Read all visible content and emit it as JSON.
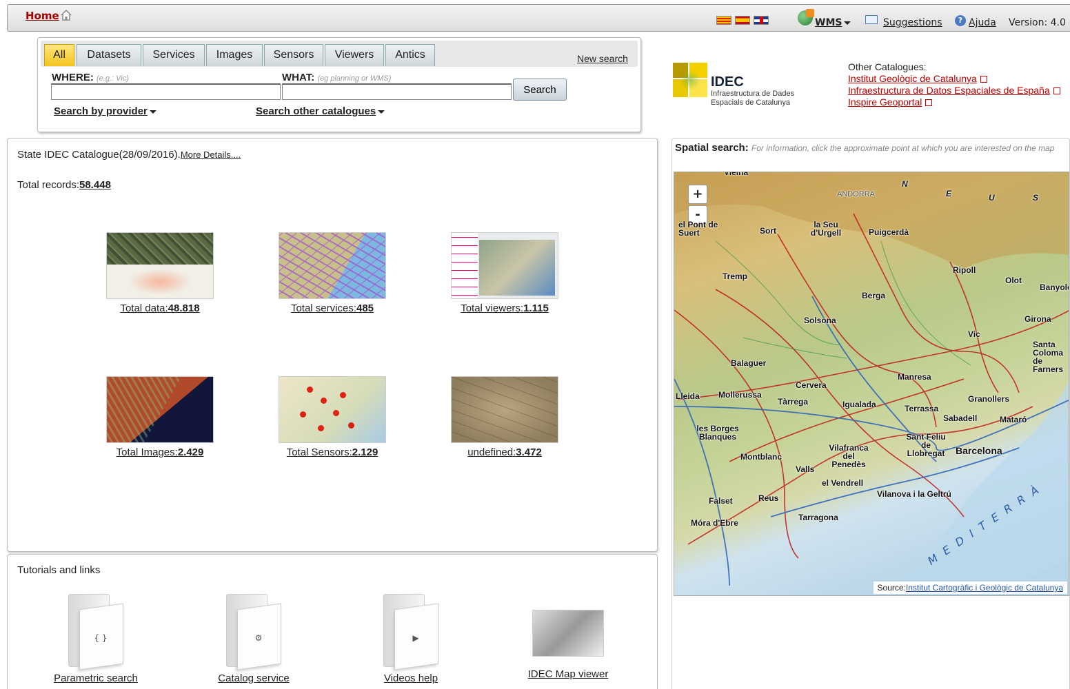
{
  "topbar": {
    "home": "Home",
    "wms": "WMS",
    "suggestions": "Suggestions",
    "help": "Ajuda",
    "version": "Version: 4.0"
  },
  "search": {
    "tabs": [
      "All",
      "Datasets",
      "Services",
      "Images",
      "Sensors",
      "Viewers",
      "Antics"
    ],
    "active_tab": "All",
    "new_search": "New search",
    "where_label": "WHERE:",
    "where_hint": "(e.g.: Vic)",
    "where_value": "",
    "what_label": "WHAT:",
    "what_hint": "(eg planning or WMS)",
    "what_value": "",
    "search_button": "Search",
    "by_provider": "Search by provider",
    "other_catalogues": "Search other catalogues"
  },
  "logo": {
    "title": "IDEC",
    "line1": "Infraestructura de Dades",
    "line2": "Espacials de Catalunya"
  },
  "other_catalogues": {
    "title": "Other Catalogues:",
    "links": [
      "Institut Geològic de Catalunya",
      "Infraestructura de Datos Espaciales de España",
      "Inspire Geoportal"
    ]
  },
  "catalogue": {
    "state": "State IDEC Catalogue(28/09/2016).",
    "more_details": "More Details....",
    "total_label": "Total records:",
    "total_value": "58.448",
    "tiles": [
      {
        "label": "Total data:",
        "value": "48.818"
      },
      {
        "label": "Total services:",
        "value": "485"
      },
      {
        "label": "Total viewers:",
        "value": "1.115"
      },
      {
        "label": "Total Images:",
        "value": "2.429"
      },
      {
        "label": "Total Sensors:",
        "value": "2.129"
      },
      {
        "label": "undefined:",
        "value": "3.472"
      }
    ]
  },
  "tutorials": {
    "title": "Tutorials and links",
    "items": [
      "Parametric search",
      "Catalog service",
      "Videos help",
      "IDEC Map viewer"
    ]
  },
  "map": {
    "title": "Spatial search:",
    "hint": "For information, click the approximate point at which you are interested on the map",
    "zoom_in": "+",
    "zoom_out": "-",
    "source_label": "Source:",
    "source_link": "Institut Cartogràfic i Geològic de Catalunya",
    "places": [
      "Vielha",
      "ANDORRA",
      "el Pont de Suert",
      "Sort",
      "la Seu d'Urgell",
      "Puigcerdà",
      "Tremp",
      "Ripoll",
      "Olot",
      "Banyoles",
      "Berga",
      "Solsona",
      "Girona",
      "Vic",
      "Santa Coloma de Farners",
      "Balaguer",
      "Manresa",
      "Cervera",
      "Lleida",
      "Mollerussa",
      "Tàrrega",
      "Igualada",
      "Granollers",
      "Terrassa",
      "Sabadell",
      "Mataró",
      "les Borges Blanques",
      "Sant Feliu de Llobregat",
      "Barcelona",
      "Vilafranca del Penedès",
      "Montblanc",
      "Valls",
      "el Vendrell",
      "Vilanova i la Geltrú",
      "Falset",
      "Reus",
      "Tarragona",
      "Móra d'Ebre"
    ],
    "sea": "MEDITERRÀ",
    "compass": [
      "N",
      "E",
      "U",
      "S"
    ]
  }
}
